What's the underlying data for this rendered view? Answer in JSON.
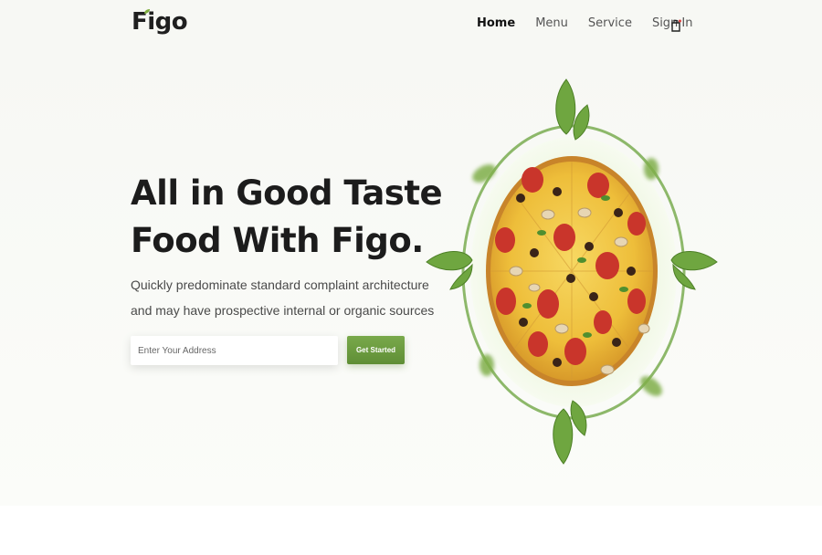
{
  "brand": {
    "name": "Figo",
    "leaf_color": "#7fae3e"
  },
  "nav": {
    "items": [
      "Home",
      "Menu",
      "Service",
      "Sign In"
    ],
    "cart_icon": "shopping-bag-icon"
  },
  "hero": {
    "title_line1": "All in Good Taste",
    "title_line2": "Food With Figo.",
    "desc_line1": "Quickly predominate standard complaint architecture",
    "desc_line2": "and may have prospective internal or organic sources",
    "address_placeholder": "Enter Your Address",
    "cta_label": "Get Started"
  },
  "colors": {
    "accent": "#6a9a3f",
    "text": "#1c1c1c",
    "header_bg": "#f7f8f4"
  }
}
